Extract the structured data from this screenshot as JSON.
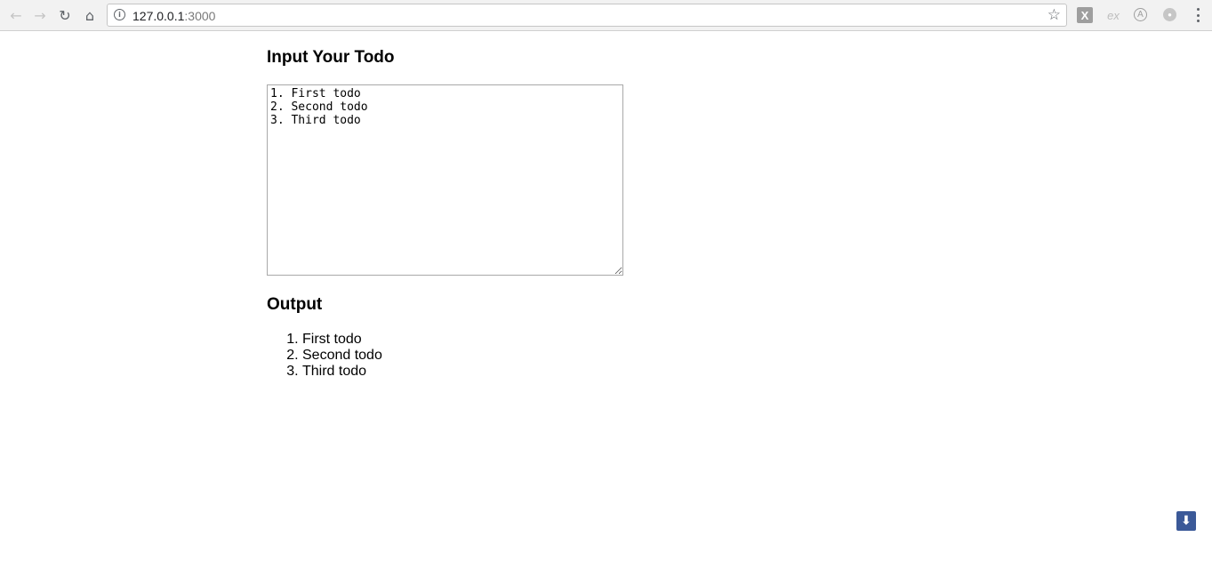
{
  "browser": {
    "back_icon": "arrow-left",
    "forward_icon": "arrow-right",
    "reload_icon": "reload",
    "home_icon": "home",
    "url_host": "127.0.0.1",
    "url_port": ":3000",
    "extensions": {
      "x_label": "X",
      "ex_label": "ex",
      "a_label": "A"
    }
  },
  "page": {
    "input_heading": "Input Your Todo",
    "textarea_value": "1. First todo\n2. Second todo\n3. Third todo",
    "output_heading": "Output",
    "output_items": [
      "First todo",
      "Second todo",
      "Third todo"
    ]
  },
  "floating_button": {
    "icon": "download-arrow-icon",
    "color": "#3b5998"
  }
}
